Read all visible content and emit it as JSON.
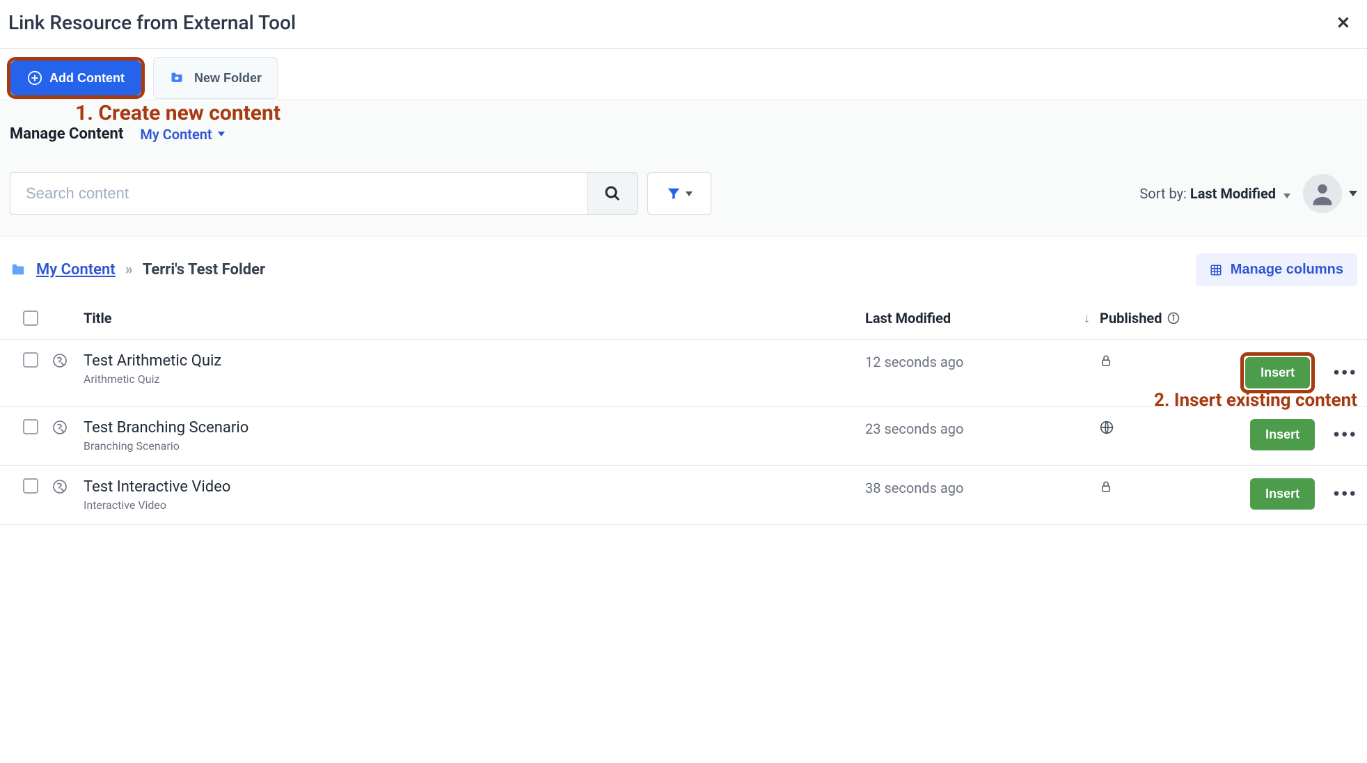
{
  "header": {
    "title": "Link Resource from External Tool"
  },
  "toolbar": {
    "add_content_label": "Add Content",
    "new_folder_label": "New Folder"
  },
  "annotations": {
    "one": "1. Create new content",
    "two": "2. Insert existing content"
  },
  "manage": {
    "title": "Manage Content",
    "dropdown": "My Content"
  },
  "search": {
    "placeholder": "Search content"
  },
  "sort": {
    "label": "Sort by:",
    "value": "Last Modified"
  },
  "breadcrumb": {
    "root": "My Content",
    "sep": "»",
    "current": "Terri's Test Folder"
  },
  "manage_columns_label": "Manage columns",
  "columns": {
    "title": "Title",
    "modified": "Last Modified",
    "published": "Published"
  },
  "rows": [
    {
      "title": "Test Arithmetic Quiz",
      "subtitle": "Arithmetic Quiz",
      "modified": "12 seconds ago",
      "pub_icon": "lock",
      "insert": "Insert",
      "highlight": true
    },
    {
      "title": "Test Branching Scenario",
      "subtitle": "Branching Scenario",
      "modified": "23 seconds ago",
      "pub_icon": "globe",
      "insert": "Insert",
      "highlight": false
    },
    {
      "title": "Test Interactive Video",
      "subtitle": "Interactive Video",
      "modified": "38 seconds ago",
      "pub_icon": "lock",
      "insert": "Insert",
      "highlight": false
    }
  ]
}
